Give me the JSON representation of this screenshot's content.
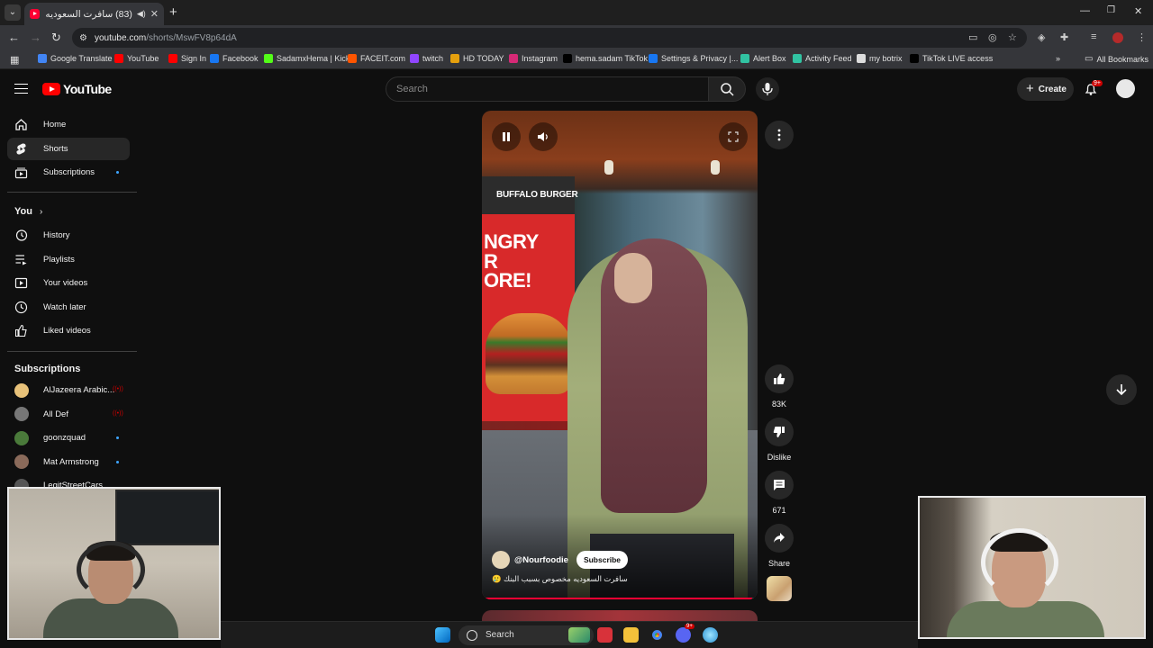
{
  "browser": {
    "tab_title": "(83) سافرت السعوديه مخص...",
    "tab_speaker_icon": "speaker-icon",
    "url_host": "youtube.com",
    "url_path": "/shorts/MswFV8p64dA",
    "all_bookmarks_label": "All Bookmarks",
    "bookmarks": [
      {
        "label": "Google Translate",
        "color": "#4285f4"
      },
      {
        "label": "YouTube",
        "color": "#ff0000"
      },
      {
        "label": "Sign In",
        "color": "#ff0000"
      },
      {
        "label": "Facebook",
        "color": "#1877f2"
      },
      {
        "label": "SadamxHema | Kick",
        "color": "#53fc18"
      },
      {
        "label": "FACEIT.com",
        "color": "#ff5500"
      },
      {
        "label": "twitch",
        "color": "#9146ff"
      },
      {
        "label": "HD TODAY",
        "color": "#e5a00d"
      },
      {
        "label": "Instagram",
        "color": "#d62976"
      },
      {
        "label": "hema.sadam TikTok",
        "color": "#000000"
      },
      {
        "label": "Settings & Privacy |...",
        "color": "#1877f2"
      },
      {
        "label": "Alert Box",
        "color": "#31c3a2"
      },
      {
        "label": "Activity Feed",
        "color": "#31c3a2"
      },
      {
        "label": "my botrix",
        "color": "#dddddd"
      },
      {
        "label": "TikTok LIVE access",
        "color": "#000000"
      }
    ]
  },
  "masthead": {
    "logo_text": "YouTube",
    "search_placeholder": "Search",
    "create_label": "Create",
    "notification_badge": "9+"
  },
  "sidebar": {
    "main_items": [
      {
        "label": "Home",
        "icon": "home-icon"
      },
      {
        "label": "Shorts",
        "icon": "shorts-icon",
        "active": true
      },
      {
        "label": "Subscriptions",
        "icon": "subscriptions-icon"
      }
    ],
    "you_label": "You",
    "you_items": [
      {
        "label": "History",
        "icon": "history-icon"
      },
      {
        "label": "Playlists",
        "icon": "playlists-icon"
      },
      {
        "label": "Your videos",
        "icon": "your-videos-icon"
      },
      {
        "label": "Watch later",
        "icon": "watch-later-icon"
      },
      {
        "label": "Liked videos",
        "icon": "liked-videos-icon"
      }
    ],
    "subscriptions_label": "Subscriptions",
    "channels": [
      {
        "name": "AlJazeera Arabic...",
        "status": "live",
        "color": "#e8c27a"
      },
      {
        "name": "All Def",
        "status": "live",
        "color": "#777777"
      },
      {
        "name": "goonzquad",
        "status": "new",
        "color": "#4a7a3a"
      },
      {
        "name": "Mat Armstrong",
        "status": "new",
        "color": "#8a6a5a"
      },
      {
        "name": "LegitStreetCars",
        "status": "none",
        "color": "#555555"
      }
    ]
  },
  "short": {
    "sign_text": "BUFFALO BURGER",
    "sign_big_text": "NGRY\nR\nORE!",
    "channel_handle": "@Nourfoodie",
    "subscribe_label": "Subscribe",
    "caption": "سافرت السعوديه مخصوص بسبب البنك 🥲",
    "progress": 0.98
  },
  "actions": {
    "likes": "83K",
    "dislike_label": "Dislike",
    "comments": "671",
    "share_label": "Share"
  },
  "taskbar": {
    "search_label": "Search",
    "discord_badge": "9+"
  }
}
